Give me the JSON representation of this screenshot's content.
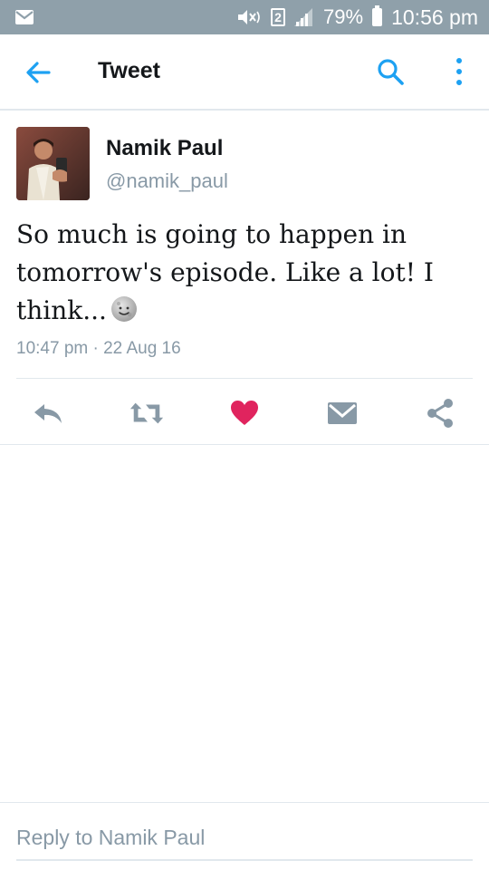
{
  "status_bar": {
    "battery": "79%",
    "time": "10:56 pm",
    "sim_slot": "2",
    "icons": [
      "mail-icon",
      "mute-icon",
      "sim-icon",
      "signal-icon",
      "battery-icon"
    ]
  },
  "app_bar": {
    "title": "Tweet",
    "icons": [
      "back-arrow-icon",
      "search-icon",
      "more-vertical-icon"
    ],
    "accent_color": "#1da1f2"
  },
  "tweet": {
    "author_name": "Namik Paul",
    "author_handle": "@namik_paul",
    "text": "So much is going to happen in tomorrow's episode. Like a lot! I think...",
    "emoji": "slightly-smiling-moon-face",
    "timestamp": "10:47 pm · 22 Aug 16"
  },
  "actions": {
    "icons": [
      "reply-icon",
      "retweet-icon",
      "like-icon",
      "direct-message-icon",
      "share-icon"
    ],
    "like_color": "#e0245e",
    "icon_color": "#8899a6"
  },
  "reply": {
    "placeholder": "Reply to Namik Paul"
  }
}
